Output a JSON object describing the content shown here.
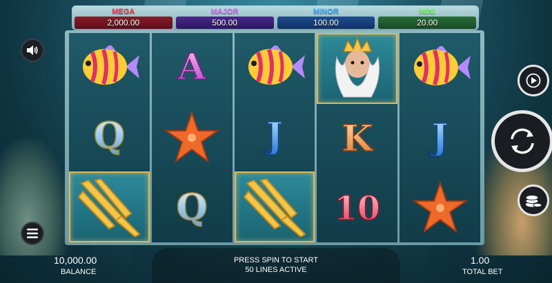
{
  "jackpots": [
    {
      "label": "MEGA",
      "value": "2,000.00"
    },
    {
      "label": "MAJOR",
      "value": "500.00"
    },
    {
      "label": "MINOR",
      "value": "100.00"
    },
    {
      "label": "MINI",
      "value": "20.00"
    }
  ],
  "reels": [
    [
      "tropical-fish",
      "letter-q",
      "trident"
    ],
    [
      "letter-a",
      "starfish",
      "letter-q"
    ],
    [
      "tropical-fish",
      "letter-j",
      "trident"
    ],
    [
      "poseidon",
      "letter-k",
      "number-10"
    ],
    [
      "tropical-fish",
      "letter-j",
      "starfish"
    ]
  ],
  "symbol_text": {
    "A": "A",
    "Q": "Q",
    "J": "J",
    "K": "K",
    "ten": "10"
  },
  "footer": {
    "balance_value": "10,000.00",
    "balance_label": "BALANCE",
    "status_line1": "PRESS SPIN TO START",
    "status_line2": "50 LINES ACTIVE",
    "bet_value": "1.00",
    "bet_label": "TOTAL BET"
  },
  "icons": {
    "sound": "speaker-icon",
    "menu": "hamburger-menu-icon",
    "autoplay": "play-icon",
    "spin": "spin-arrows-icon",
    "bet": "coin-stack-icon"
  },
  "colors": {
    "mega": "#ff3a4a",
    "major": "#d67cff",
    "minor": "#3fb0ff",
    "mini": "#7cff6a",
    "frame_gold": "#e8b64a"
  }
}
